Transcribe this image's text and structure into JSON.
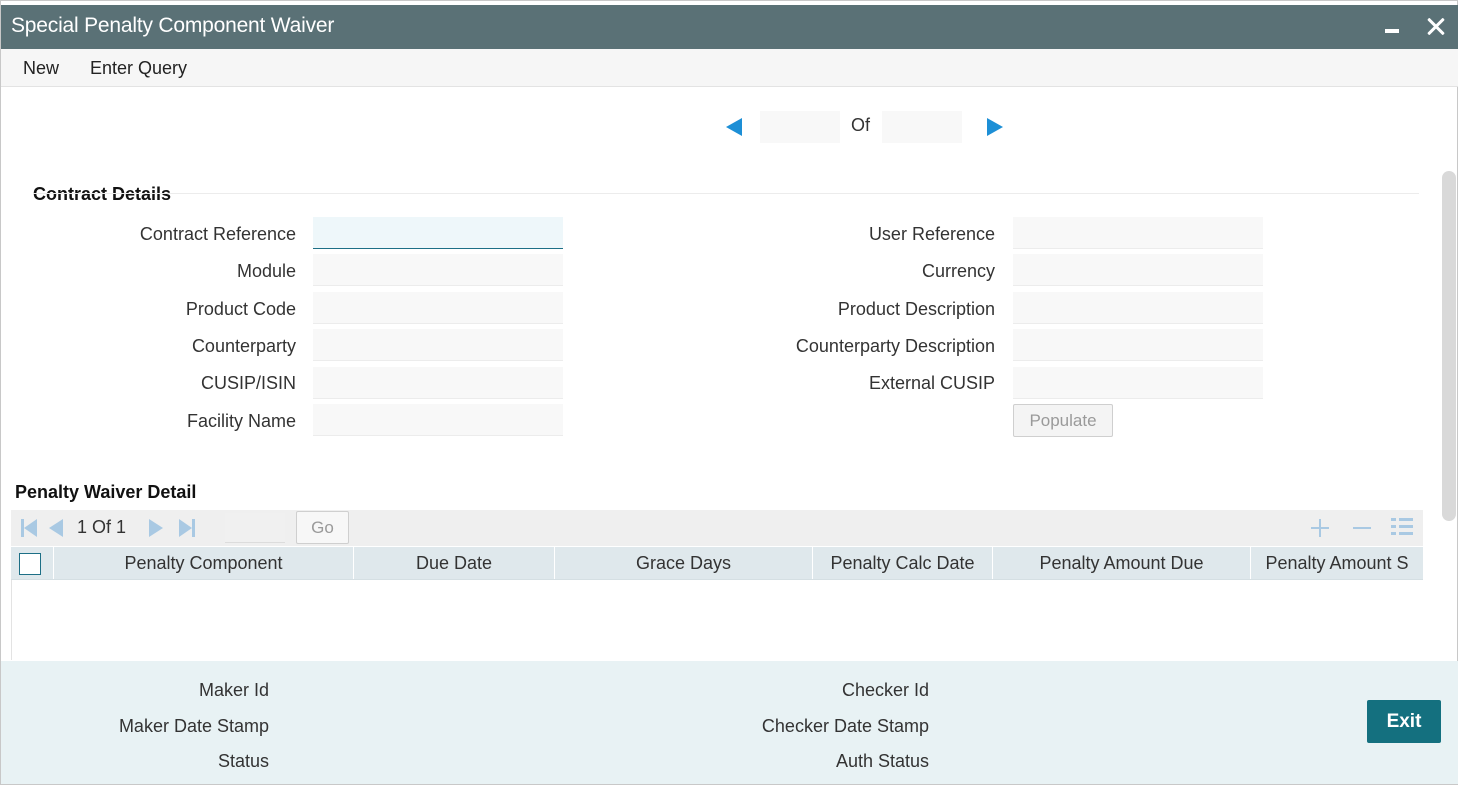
{
  "window": {
    "title": "Special Penalty Component Waiver"
  },
  "menu": {
    "new_label": "New",
    "enter_query_label": "Enter Query"
  },
  "record_pager": {
    "current": "",
    "of_label": "Of",
    "total": ""
  },
  "contract_details": {
    "title": "Contract Details",
    "fields_left": [
      {
        "label": "Contract Reference",
        "value": ""
      },
      {
        "label": "Module",
        "value": ""
      },
      {
        "label": "Product Code",
        "value": ""
      },
      {
        "label": "Counterparty",
        "value": ""
      },
      {
        "label": "CUSIP/ISIN",
        "value": ""
      },
      {
        "label": "Facility Name",
        "value": ""
      }
    ],
    "fields_right": [
      {
        "label": "User Reference",
        "value": ""
      },
      {
        "label": "Currency",
        "value": ""
      },
      {
        "label": "Product Description",
        "value": ""
      },
      {
        "label": "Counterparty Description",
        "value": ""
      },
      {
        "label": "External CUSIP",
        "value": ""
      }
    ],
    "populate_label": "Populate"
  },
  "penalty_waiver": {
    "title": "Penalty Waiver Detail",
    "page_info": "1 Of 1",
    "go_label": "Go",
    "columns": [
      "Penalty Component",
      "Due Date",
      "Grace Days",
      "Penalty Calc Date",
      "Penalty Amount Due",
      "Penalty Amount S"
    ]
  },
  "footer": {
    "maker_id": "Maker Id",
    "maker_date_stamp": "Maker Date Stamp",
    "status": "Status",
    "checker_id": "Checker Id",
    "checker_date_stamp": "Checker Date Stamp",
    "auth_status": "Auth Status",
    "exit_label": "Exit"
  },
  "colors": {
    "titlebar": "#5a7176",
    "accent": "#1d8fd6",
    "primary_button": "#14707f",
    "footer_bg": "#e8f2f4",
    "grid_header_bg": "#dfe8ec"
  }
}
